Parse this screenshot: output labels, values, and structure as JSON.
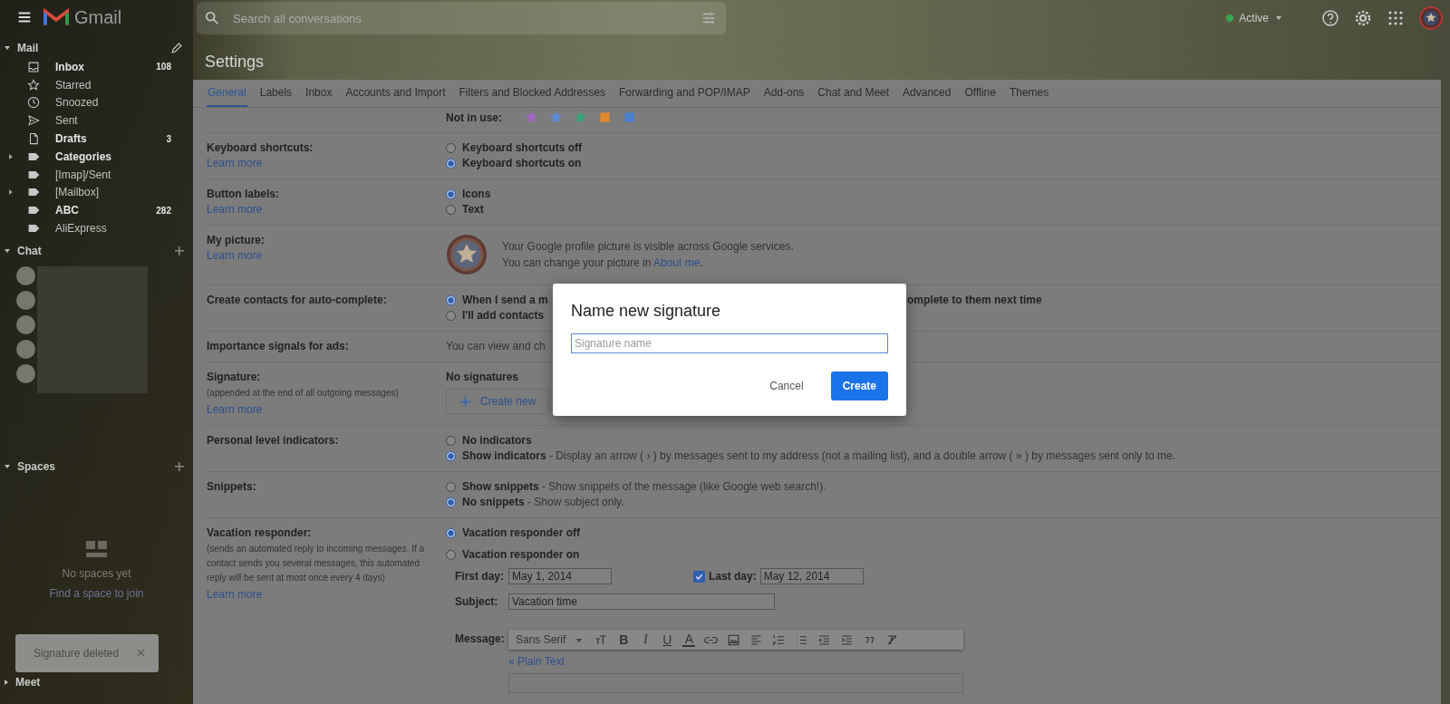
{
  "header": {
    "app_name": "Gmail",
    "search": {
      "placeholder": "Search all conversations"
    },
    "status": {
      "label": "Active",
      "color": "#34a853"
    }
  },
  "sidebar": {
    "mail_heading": "Mail",
    "items": [
      {
        "kind": "inbox",
        "label": "Inbox",
        "bold": true,
        "count": "108",
        "expandable": false
      },
      {
        "kind": "star",
        "label": "Starred",
        "bold": false,
        "expandable": false
      },
      {
        "kind": "clock",
        "label": "Snoozed",
        "bold": false,
        "expandable": false
      },
      {
        "kind": "send",
        "label": "Sent",
        "bold": false,
        "expandable": false
      },
      {
        "kind": "file",
        "label": "Drafts",
        "bold": true,
        "count": "3",
        "expandable": false
      },
      {
        "kind": "label",
        "label": "Categories",
        "bold": true,
        "expandable": true
      },
      {
        "kind": "label",
        "label": "[Imap]/Sent",
        "bold": false,
        "expandable": false
      },
      {
        "kind": "label",
        "label": "[Mailbox]",
        "bold": false,
        "expandable": true
      },
      {
        "kind": "label",
        "label": "ABC",
        "bold": true,
        "count": "282",
        "expandable": false
      },
      {
        "kind": "label",
        "label": "AliExpress",
        "bold": false,
        "expandable": false
      }
    ],
    "chat_heading": "Chat",
    "spaces_heading": "Spaces",
    "spaces_empty": "No spaces yet",
    "spaces_link": "Find a space to join",
    "toast": "Signature deleted",
    "meet_heading": "Meet"
  },
  "page_title": "Settings",
  "tabs": [
    {
      "label": "General",
      "selected": true
    },
    {
      "label": "Labels",
      "selected": false
    },
    {
      "label": "Inbox",
      "selected": false
    },
    {
      "label": "Accounts and Import",
      "selected": false
    },
    {
      "label": "Filters and Blocked Addresses",
      "selected": false
    },
    {
      "label": "Forwarding and POP/IMAP",
      "selected": false
    },
    {
      "label": "Add-ons",
      "selected": false
    },
    {
      "label": "Chat and Meet",
      "selected": false
    },
    {
      "label": "Advanced",
      "selected": false
    },
    {
      "label": "Offline",
      "selected": false
    },
    {
      "label": "Themes",
      "selected": false
    }
  ],
  "rows": [
    {
      "kind": "stars",
      "value_label": "Not in use:",
      "icons": [
        {
          "kind": "star",
          "color": "#a066c8"
        },
        {
          "kind": "star",
          "color": "#5a8ad8"
        },
        {
          "kind": "star",
          "color": "#3aa57a"
        },
        {
          "kind": "square",
          "color": "#e08a2e"
        },
        {
          "kind": "square",
          "color": "#4a7fd0"
        }
      ]
    },
    {
      "kind": "radio",
      "label": "Keyboard shortcuts:",
      "link": "Learn more",
      "options": [
        {
          "text": "**Keyboard shortcuts off**",
          "selected": false
        },
        {
          "text": "**Keyboard shortcuts on**",
          "selected": true
        }
      ]
    },
    {
      "kind": "radio",
      "label": "Button labels:",
      "link": "Learn more",
      "options": [
        {
          "text": "**Icons**",
          "selected": true
        },
        {
          "text": "**Text**",
          "selected": false
        }
      ]
    },
    {
      "kind": "picture",
      "label": "My picture:",
      "link": "Learn more",
      "line_1": "Your Google profile picture is visible across Google services.",
      "line_2": "You can change your picture in ",
      "line_2_link": "About me",
      "line_2_end": "."
    },
    {
      "kind": "radio",
      "label": "Create contacts for auto-complete:",
      "options": [
        {
          "text": "**When I send a m**",
          "text_after_dialog": "omplete to them next time",
          "selected": true
        },
        {
          "text": "**I'll add contacts**",
          "selected": false
        }
      ]
    },
    {
      "kind": "text",
      "label": "Importance signals for ads:",
      "value": "You can view and ch"
    },
    {
      "kind": "signature",
      "label": "Signature:",
      "sublabel": "(appended at the end of all outgoing messages)",
      "link": "Learn more",
      "value": "No signatures",
      "button": "Create new"
    },
    {
      "kind": "radio",
      "label": "Personal level indicators:",
      "options": [
        {
          "text": "**No indicators**",
          "selected": false
        },
        {
          "text": "**Show indicators** - Display an arrow ( › ) by messages sent to my address (not a mailing list), and a double arrow ( » ) by messages sent only to me.",
          "selected": true
        }
      ]
    },
    {
      "kind": "radio",
      "label": "Snippets:",
      "options": [
        {
          "text": "**Show snippets** - Show snippets of the message (like Google web search!).",
          "selected": false
        },
        {
          "text": "**No snippets** - Show subject only.",
          "selected": true
        }
      ]
    },
    {
      "kind": "vacation",
      "label": "Vacation responder:",
      "sublabel": "(sends an automated reply to incoming messages. If a contact sends you several messages, this automated reply will be sent at most once every 4 days)",
      "link": "Learn more",
      "options": [
        {
          "text": "**Vacation responder off**",
          "selected": true
        },
        {
          "text": "**Vacation responder on**",
          "selected": false
        }
      ],
      "first_day": {
        "label": "First day:",
        "value": "May 1, 2014"
      },
      "last_day": {
        "label": "Last day:",
        "value": "May 12, 2014",
        "checked": true
      },
      "subject": {
        "label": "Subject:",
        "value": "Vacation time"
      },
      "message_label": "Message:",
      "toolbar": [
        {
          "kind": "font",
          "label": "Sans Serif"
        },
        {
          "kind": "size"
        },
        {
          "kind": "bold",
          "label": "B"
        },
        {
          "kind": "italic",
          "label": "I"
        },
        {
          "kind": "underline",
          "label": "U"
        },
        {
          "kind": "color",
          "label": "A"
        },
        {
          "kind": "link"
        },
        {
          "kind": "image"
        },
        {
          "kind": "align"
        },
        {
          "kind": "numbered"
        },
        {
          "kind": "bulleted"
        },
        {
          "kind": "outdent"
        },
        {
          "kind": "indent"
        },
        {
          "kind": "quote"
        },
        {
          "kind": "clear"
        }
      ],
      "plain_text_link": "« Plain Text"
    }
  ],
  "dialog": {
    "title": "Name new signature",
    "placeholder": "Signature name",
    "cancel": "Cancel",
    "confirm": "Create"
  }
}
